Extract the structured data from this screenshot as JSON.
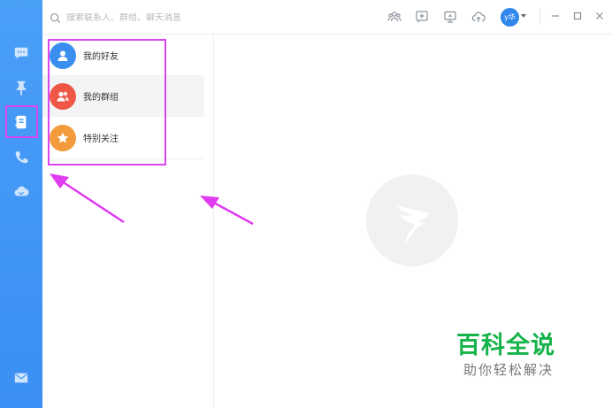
{
  "search": {
    "placeholder": "搜索联系人、群组、聊天消息"
  },
  "user": {
    "avatar_text": "y华"
  },
  "contacts_menu": {
    "items": [
      {
        "label": "我的好友",
        "icon": "person-icon",
        "color": "#3a8ef0"
      },
      {
        "label": "我的群组",
        "icon": "group-icon",
        "color": "#ee5745"
      },
      {
        "label": "特别关注",
        "icon": "star-icon",
        "color": "#f39a3d"
      }
    ]
  },
  "nav": {
    "items": [
      "chat-icon",
      "pin-icon",
      "contacts-icon",
      "phone-icon",
      "cloud-icon",
      "mail-icon"
    ],
    "active": "contacts-icon"
  },
  "watermark": {
    "title": "百科全说",
    "subtitle": "助你轻松解决"
  },
  "colors": {
    "rail": "#4a9ff7",
    "highlight": "#d946ef",
    "brand": "#2f87ec",
    "watermark": "#16b34a"
  }
}
